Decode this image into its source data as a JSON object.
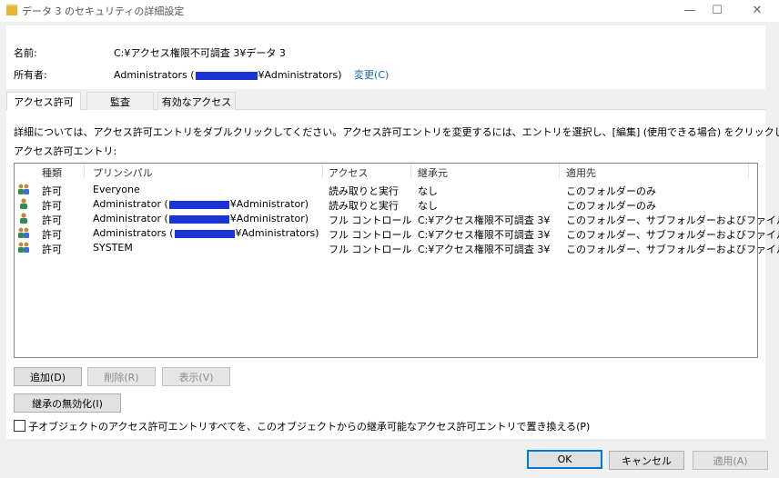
{
  "window": {
    "title": "データ 3 のセキュリティの詳細設定",
    "minimize_icon": "—",
    "maximize_icon": "☐",
    "close_icon": "✕"
  },
  "info": {
    "name_label": "名前:",
    "name_value": "C:¥アクセス権限不可調査 3¥データ 3",
    "owner_label": "所有者:",
    "owner_value_prefix": "Administrators (",
    "owner_value_suffix": "¥Administrators)",
    "owner_change_link": "変更(C)"
  },
  "tabs": [
    {
      "label": "アクセス許可",
      "active": true
    },
    {
      "label": "監査",
      "active": false
    },
    {
      "label": "有効なアクセス",
      "active": false
    }
  ],
  "instructions": "詳細については、アクセス許可エントリをダブルクリックしてください。アクセス許可エントリを変更するには、エントリを選択し、[編集] (使用できる場合) をクリックします。",
  "entries_label": "アクセス許可エントリ:",
  "table": {
    "headers": [
      "種類",
      "プリンシパル",
      "アクセス",
      "継承元",
      "適用先"
    ],
    "rows": [
      {
        "icon": "group-icon",
        "type": "許可",
        "principal_prefix": "Everyone",
        "principal_suffix": "",
        "masked": false,
        "access": "読み取りと実行",
        "inherited": "なし",
        "applies": "このフォルダーのみ"
      },
      {
        "icon": "user-icon",
        "type": "許可",
        "principal_prefix": "Administrator (",
        "principal_suffix": "¥Administrator)",
        "masked": true,
        "access": "読み取りと実行",
        "inherited": "なし",
        "applies": "このフォルダーのみ"
      },
      {
        "icon": "user-icon",
        "type": "許可",
        "principal_prefix": "Administrator (",
        "principal_suffix": "¥Administrator)",
        "masked": true,
        "access": "フル コントロール",
        "inherited": "C:¥アクセス権限不可調査 3¥",
        "applies": "このフォルダー、サブフォルダーおよびファイル"
      },
      {
        "icon": "group-icon",
        "type": "許可",
        "principal_prefix": "Administrators (",
        "principal_suffix": "¥Administrators)",
        "masked": true,
        "access": "フル コントロール",
        "inherited": "C:¥アクセス権限不可調査 3¥",
        "applies": "このフォルダー、サブフォルダーおよびファイル"
      },
      {
        "icon": "group-icon",
        "type": "許可",
        "principal_prefix": "SYSTEM",
        "principal_suffix": "",
        "masked": false,
        "access": "フル コントロール",
        "inherited": "C:¥アクセス権限不可調査 3¥",
        "applies": "このフォルダー、サブフォルダーおよびファイル"
      }
    ]
  },
  "buttons": {
    "add": "追加(D)",
    "remove": "削除(R)",
    "view": "表示(V)",
    "disable_inheritance": "継承の無効化(I)",
    "ok": "OK",
    "cancel": "キャンセル",
    "apply": "適用(A)"
  },
  "replace_checkbox_label": "子オブジェクトのアクセス許可エントリすべてを、このオブジェクトからの継承可能なアクセス許可エントリで置き換える(P)",
  "colors": {
    "accent": "#0078d7",
    "link": "#1a64b8",
    "redaction": "#1a34d6"
  }
}
